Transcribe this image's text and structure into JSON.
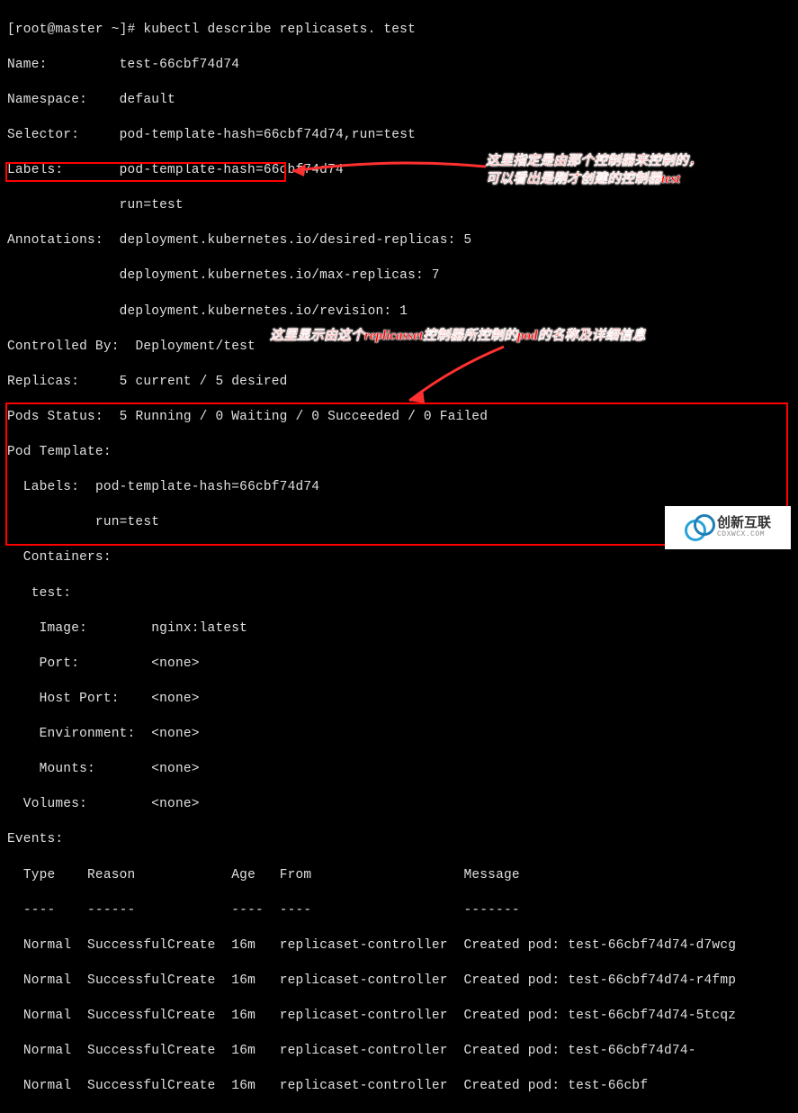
{
  "prompt": "[root@master ~]# ",
  "command": "kubectl describe replicasets. test",
  "fields": {
    "name_label": "Name:",
    "name_value": "test-66cbf74d74",
    "namespace_label": "Namespace:",
    "namespace_value": "default",
    "selector_label": "Selector:",
    "selector_value": "pod-template-hash=66cbf74d74,run=test",
    "labels_label": "Labels:",
    "labels_value1": "pod-template-hash=66cbf74d74",
    "labels_value2": "run=test",
    "annotations_label": "Annotations:",
    "annotations_value1": "deployment.kubernetes.io/desired-replicas: 5",
    "annotations_value2": "deployment.kubernetes.io/max-replicas: 7",
    "annotations_value3": "deployment.kubernetes.io/revision: 1",
    "controlled_label": "Controlled By:",
    "controlled_value": "Deployment/test",
    "replicas_label": "Replicas:",
    "replicas_value": "5 current / 5 desired",
    "pods_status_label": "Pods Status:",
    "pods_status_value": "5 Running / 0 Waiting / 0 Succeeded / 0 Failed",
    "pod_template_label": "Pod Template:",
    "pt_labels_label": "  Labels:",
    "pt_labels_value1": "pod-template-hash=66cbf74d74",
    "pt_labels_value2": "           run=test",
    "containers_label": "  Containers:",
    "container_name": "   test:",
    "image_label": "    Image:",
    "image_value": "nginx:latest",
    "port_label": "    Port:",
    "port_value": "<none>",
    "hostport_label": "    Host Port:",
    "hostport_value": "<none>",
    "env_label": "    Environment:",
    "env_value": "<none>",
    "mounts_label": "    Mounts:",
    "mounts_value": "<none>",
    "volumes_label": "  Volumes:",
    "volumes_value": "<none>"
  },
  "events": {
    "header": "Events:",
    "columns": {
      "type": "Type",
      "reason": "Reason",
      "age": "Age",
      "from": "From",
      "message": "Message"
    },
    "divider": {
      "type": "----",
      "reason": "------",
      "age": "----",
      "from": "----",
      "message": "-------"
    },
    "rows": [
      {
        "type": "Normal",
        "reason": "SuccessfulCreate",
        "age": "16m",
        "from": "replicaset-controller",
        "message": "Created pod: test-66cbf74d74-d7wcg"
      },
      {
        "type": "Normal",
        "reason": "SuccessfulCreate",
        "age": "16m",
        "from": "replicaset-controller",
        "message": "Created pod: test-66cbf74d74-r4fmp"
      },
      {
        "type": "Normal",
        "reason": "SuccessfulCreate",
        "age": "16m",
        "from": "replicaset-controller",
        "message": "Created pod: test-66cbf74d74-5tcqz"
      },
      {
        "type": "Normal",
        "reason": "SuccessfulCreate",
        "age": "16m",
        "from": "replicaset-controller",
        "message": "Created pod: test-66cbf74d74-"
      },
      {
        "type": "Normal",
        "reason": "SuccessfulCreate",
        "age": "16m",
        "from": "replicaset-controller",
        "message": "Created pod: test-66cbf"
      }
    ]
  },
  "annotations": {
    "a1_line1": "这里指定是由那个控制器来控制的，",
    "a1_line2": "可以看出是刚才创建的控制器test",
    "a2": "这里显示由这个replicasset控制器所控制的pod的名称及详细信息"
  },
  "watermark": {
    "brand": "创新互联",
    "sub": "CDXWCX.COM"
  }
}
